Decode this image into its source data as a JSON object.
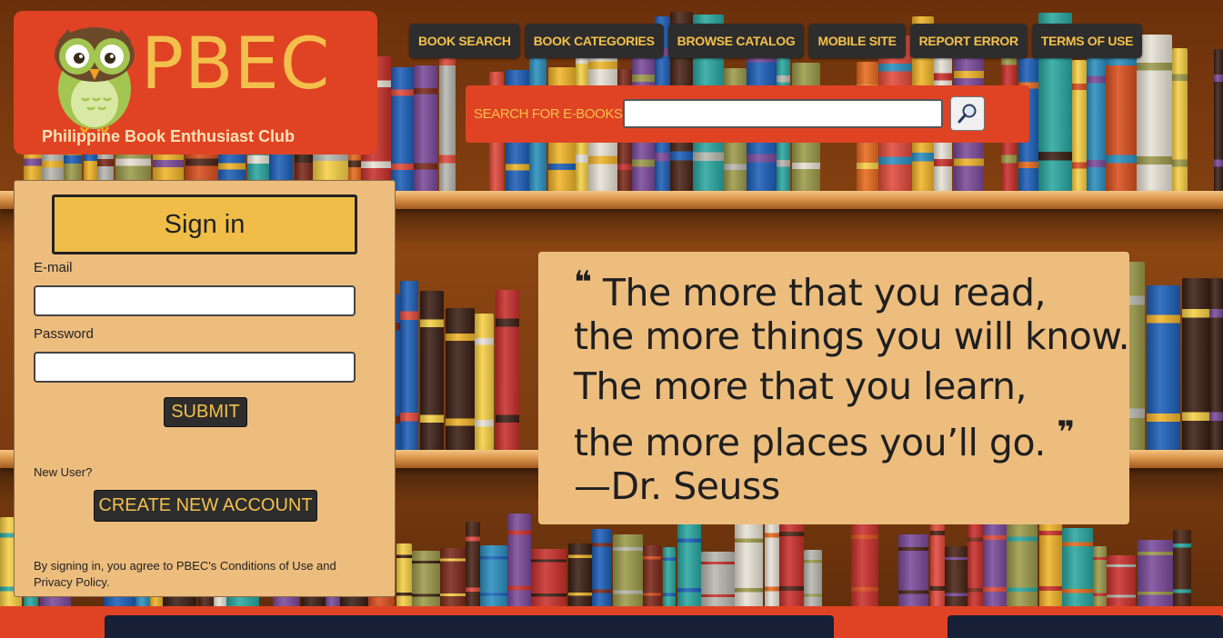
{
  "logo": {
    "title": "PBEC",
    "subtitle": "Philippine Book Enthusiast Club"
  },
  "nav": {
    "items": [
      {
        "label": "BOOK SEARCH"
      },
      {
        "label": "BOOK CATEGORIES"
      },
      {
        "label": "BROWSE CATALOG"
      },
      {
        "label": "MOBILE SITE"
      },
      {
        "label": "REPORT ERROR"
      },
      {
        "label": "TERMS OF USE"
      }
    ]
  },
  "search": {
    "label": "SEARCH FOR E-BOOKS",
    "value": "",
    "button_icon": "magnifier-icon"
  },
  "signin": {
    "title": "Sign in",
    "email_label": "E-mail",
    "email_value": "",
    "password_label": "Password",
    "password_value": "",
    "submit_label": "SUBMIT",
    "new_user_label": "New User?",
    "create_account_label": "CREATE NEW ACCOUNT",
    "terms_line1": "By signing in, you agree to PBEC's Conditions of Use and",
    "terms_line2": "Privacy Policy."
  },
  "quote": {
    "line1": "The more that you read,",
    "line2": "the more things you will know.",
    "line3": "The more that you learn,",
    "line4": "the more places you’ll go.",
    "author": "—Dr. Seuss",
    "open_mark": "❝",
    "close_mark": "❞"
  },
  "colors": {
    "brand_red": "#e04324",
    "brand_yellow": "#f3c04b",
    "panel_tan": "#edbd7e",
    "button_dark": "#2e2d2d"
  }
}
